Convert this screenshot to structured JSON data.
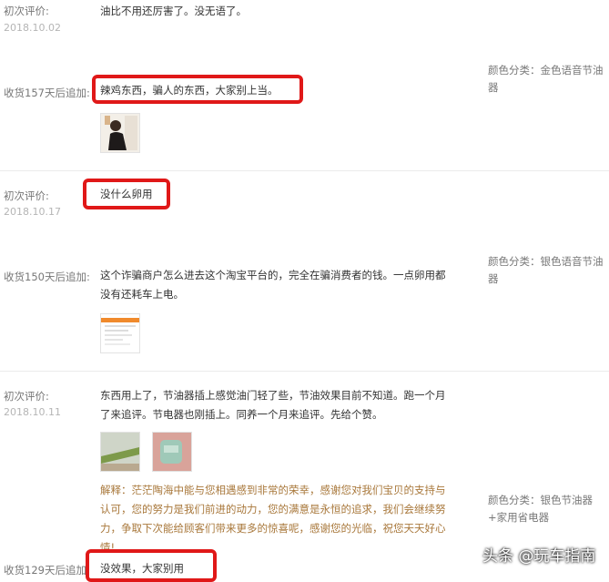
{
  "reviews": [
    {
      "initial_label": "初次评价:",
      "initial_date": "2018.10.02",
      "initial_text": "油比不用还厉害了。没无语了。",
      "followup_label": "收货157天后追加:",
      "followup_text": "辣鸡东西，骗人的东西，大家别上当。",
      "sku_text": "颜色分类：金色语音节油器"
    },
    {
      "initial_label": "初次评价:",
      "initial_date": "2018.10.17",
      "initial_text": "没什么卵用",
      "followup_label": "收货150天后追加:",
      "followup_text": "这个诈骗商户怎么进去这个淘宝平台的，完全在骗消费者的钱。一点卵用都没有还耗车上电。",
      "sku_text": "颜色分类：银色语音节油器"
    },
    {
      "initial_label": "初次评价:",
      "initial_date": "2018.10.11",
      "initial_text": "东西用上了，节油器插上感觉油门轻了些，节油效果目前不知道。跑一个月了来追评。节电器也刚插上。同养一个月来追评。先给个赞。",
      "reply_text": "解释：茫茫陶海中能与您相遇感到非常的荣幸，感谢您对我们宝贝的支持与认可，您的努力是我们前进的动力，您的满意是永恒的追求，我们会继续努力，争取下次能给顾客们带来更多的惊喜呢，感谢您的光临，祝您天天好心情!",
      "followup_label": "收货129天后追加:",
      "followup_text": "没效果，大家别用",
      "sku_text": "颜色分类：银色节油器+家用省电器"
    }
  ],
  "watermark": {
    "text": "头条 @玩车指南",
    "icon": "feather-icon"
  },
  "colors": {
    "highlight_box": "#e01818",
    "seller_reply": "#a8773a",
    "label_gray": "#777777"
  }
}
